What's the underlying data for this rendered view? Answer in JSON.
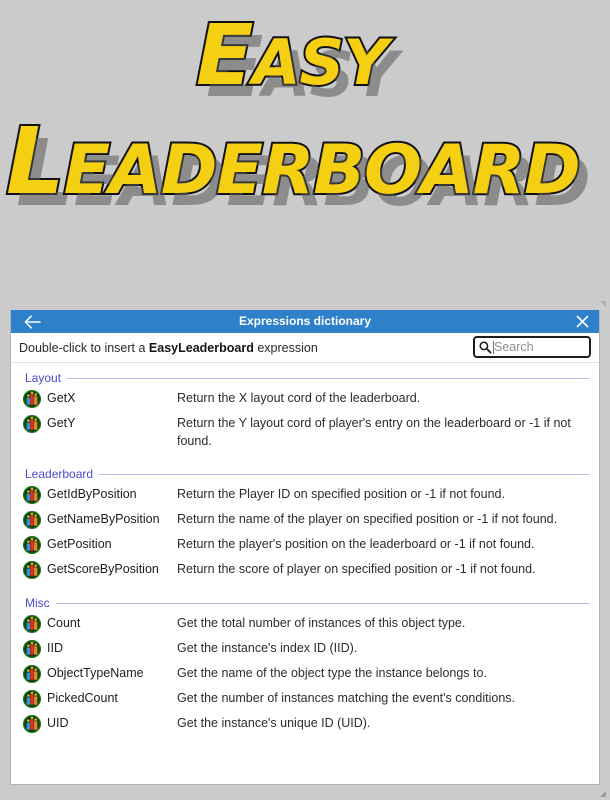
{
  "logo": {
    "line1_first": "E",
    "line1_rest": "ASY",
    "line2_first": "L",
    "line2_rest": "EADERBOARD",
    "text_color": "#f5cf12",
    "outline_color": "#111111",
    "shadow_color": "#5a5a5a"
  },
  "page": {
    "background": "#cccccc"
  },
  "dialog": {
    "titlebar": {
      "title": "Expressions dictionary",
      "background": "#2e80ca",
      "back_icon": "arrow-left-icon",
      "close_icon": "close-icon"
    },
    "info": {
      "prefix": "Double-click to insert a ",
      "object_name": "EasyLeaderboard",
      "suffix": " expression"
    },
    "search": {
      "placeholder": "Search",
      "value": "",
      "icon": "search-icon"
    },
    "groups": [
      {
        "title": "Layout",
        "rows": [
          {
            "icon": "leaderboard-object-icon",
            "name": "GetX",
            "description": "Return the X layout cord of the leaderboard."
          },
          {
            "icon": "leaderboard-object-icon",
            "name": "GetY",
            "description": "Return the Y layout cord of player's entry on the leaderboard or -1 if not found."
          }
        ]
      },
      {
        "title": "Leaderboard",
        "rows": [
          {
            "icon": "leaderboard-object-icon",
            "name": "GetIdByPosition",
            "description": "Return the Player ID on specified position or -1 if not found."
          },
          {
            "icon": "leaderboard-object-icon",
            "name": "GetNameByPosition",
            "description": "Return the name of the player on specified position or -1 if not found."
          },
          {
            "icon": "leaderboard-object-icon",
            "name": "GetPosition",
            "description": "Return the player's position on the leaderboard or -1 if not found."
          },
          {
            "icon": "leaderboard-object-icon",
            "name": "GetScoreByPosition",
            "description": "Return the score of player on specified position or -1 if not found."
          }
        ]
      },
      {
        "title": "Misc",
        "rows": [
          {
            "icon": "leaderboard-object-icon",
            "name": "Count",
            "description": "Get the total number of instances of this object type."
          },
          {
            "icon": "leaderboard-object-icon",
            "name": "IID",
            "description": "Get the instance's index ID (IID)."
          },
          {
            "icon": "leaderboard-object-icon",
            "name": "ObjectTypeName",
            "description": "Get the name of the object type the instance belongs to."
          },
          {
            "icon": "leaderboard-object-icon",
            "name": "PickedCount",
            "description": "Get the number of instances matching the event's conditions."
          },
          {
            "icon": "leaderboard-object-icon",
            "name": "UID",
            "description": "Get the instance's unique ID (UID)."
          }
        ]
      }
    ],
    "group_header_color": "#4a4acb"
  }
}
